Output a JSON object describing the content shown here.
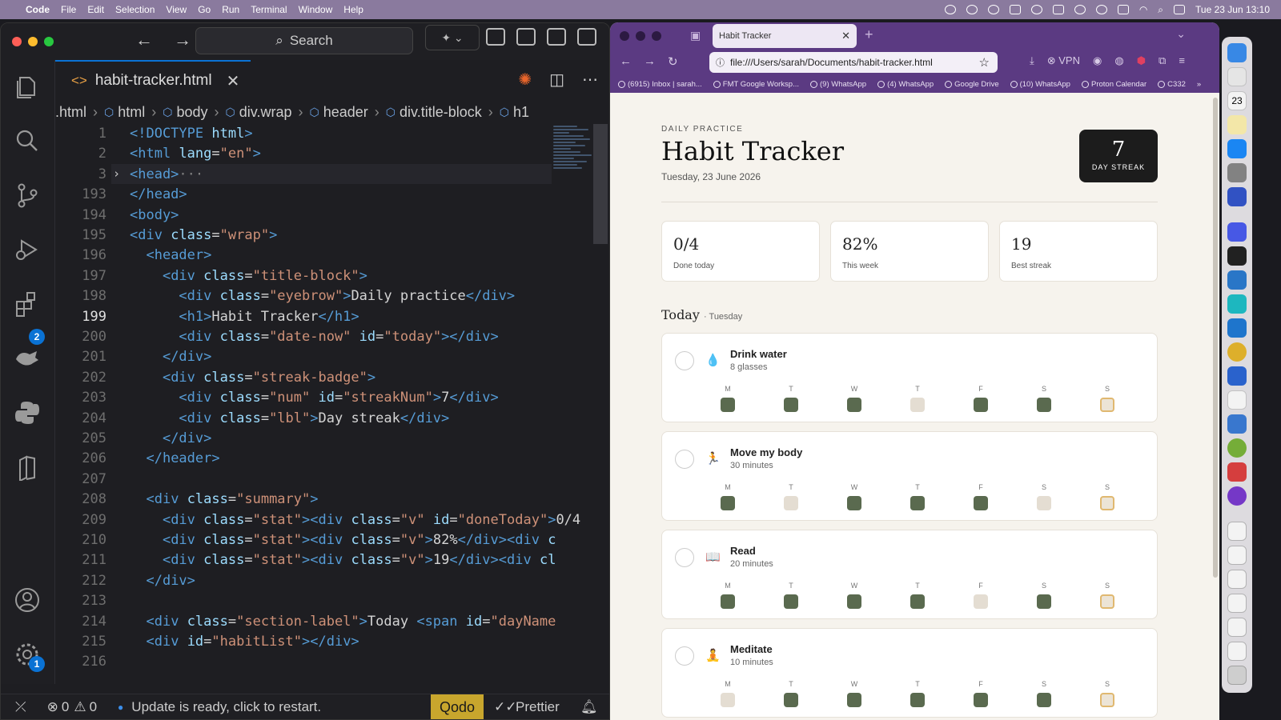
{
  "menubar": {
    "app": "Code",
    "items": [
      "File",
      "Edit",
      "Selection",
      "View",
      "Go",
      "Run",
      "Terminal",
      "Window",
      "Help"
    ],
    "datetime": "Tue 23 Jun  13:10"
  },
  "vscode": {
    "search": "Search",
    "tab_label": "habit-tracker.html",
    "breadcrumb": [
      ".html",
      "html",
      "body",
      "div.wrap",
      "header",
      "div.title-block",
      "h1"
    ],
    "activity_badges": {
      "extensions": "2",
      "settings": "1"
    },
    "status": {
      "errors": "0",
      "warnings": "0",
      "message": "Update is ready, click to restart.",
      "qodo": "Qodo",
      "prettier": "Prettier"
    },
    "code_lines": [
      {
        "n": "1"
      },
      {
        "n": "2"
      },
      {
        "n": "3"
      },
      {
        "n": "193"
      },
      {
        "n": "194"
      },
      {
        "n": "195"
      },
      {
        "n": "196"
      },
      {
        "n": "197"
      },
      {
        "n": "198"
      },
      {
        "n": "199"
      },
      {
        "n": "200"
      },
      {
        "n": "201"
      },
      {
        "n": "202"
      },
      {
        "n": "203"
      },
      {
        "n": "204"
      },
      {
        "n": "205"
      },
      {
        "n": "206"
      },
      {
        "n": "207"
      },
      {
        "n": "208"
      },
      {
        "n": "209"
      },
      {
        "n": "210"
      },
      {
        "n": "211"
      },
      {
        "n": "212"
      },
      {
        "n": "213"
      },
      {
        "n": "214"
      },
      {
        "n": "215"
      },
      {
        "n": "216"
      }
    ]
  },
  "browser": {
    "tab_title": "Habit Tracker",
    "url": "file:///Users/sarah/Documents/habit-tracker.html",
    "vpn": "VPN",
    "bookmarks": [
      "(6915) Inbox | sarah...",
      "FMT Google Worksp...",
      "(9) WhatsApp",
      "(4) WhatsApp",
      "Google Drive",
      "(10) WhatsApp",
      "Proton Calendar",
      "C332"
    ]
  },
  "app": {
    "eyebrow": "DAILY PRACTICE",
    "title": "Habit Tracker",
    "date": "Tuesday, 23 June 2026",
    "streak_num": "7",
    "streak_label": "DAY STREAK",
    "stats": [
      {
        "value": "0/4",
        "label": "Done today"
      },
      {
        "value": "82%",
        "label": "This week"
      },
      {
        "value": "19",
        "label": "Best streak"
      }
    ],
    "section_label": "Today",
    "day_name": "· Tuesday",
    "day_letters": [
      "M",
      "T",
      "W",
      "T",
      "F",
      "S",
      "S"
    ],
    "habits": [
      {
        "name": "Drink water",
        "sub": "8 glasses",
        "icon": "💧",
        "week": [
          1,
          1,
          1,
          0,
          1,
          1,
          2
        ]
      },
      {
        "name": "Move my body",
        "sub": "30 minutes",
        "icon": "🏃",
        "week": [
          1,
          0,
          1,
          1,
          1,
          0,
          2
        ]
      },
      {
        "name": "Read",
        "sub": "20 minutes",
        "icon": "📖",
        "week": [
          1,
          1,
          1,
          1,
          0,
          1,
          2
        ]
      },
      {
        "name": "Meditate",
        "sub": "10 minutes",
        "icon": "🧘",
        "week": [
          0,
          1,
          1,
          1,
          1,
          1,
          2
        ]
      }
    ]
  }
}
